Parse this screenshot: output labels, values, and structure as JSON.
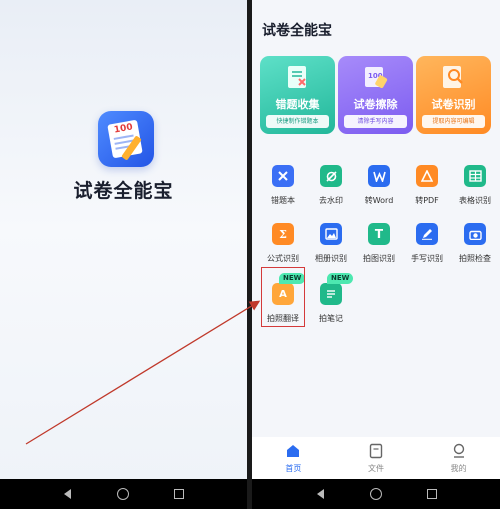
{
  "splash": {
    "app_name": "试卷全能宝"
  },
  "home": {
    "app_title": "试卷全能宝",
    "feature_cards": [
      {
        "title": "错题收集",
        "subtitle": "快捷制作错题本",
        "icon": "mistake-collection-icon"
      },
      {
        "title": "试卷擦除",
        "subtitle": "清除手写内容",
        "icon": "paper-erase-icon"
      },
      {
        "title": "试卷识别",
        "subtitle": "提取内容可编辑",
        "icon": "paper-recognition-icon"
      }
    ],
    "tools": [
      {
        "label": "错题本",
        "icon": "x-icon",
        "color": "#3b6ff5"
      },
      {
        "label": "去水印",
        "icon": "watermark-icon",
        "color": "#20b98a"
      },
      {
        "label": "转Word",
        "icon": "word-icon",
        "color": "#2b6cf0"
      },
      {
        "label": "转PDF",
        "icon": "pdf-icon",
        "color": "#ff8a24"
      },
      {
        "label": "表格识别",
        "icon": "table-icon",
        "color": "#20b98a"
      },
      {
        "label": "公式识别",
        "icon": "formula-icon",
        "color": "#ff8a24"
      },
      {
        "label": "相册识别",
        "icon": "album-icon",
        "color": "#2b6cf0"
      },
      {
        "label": "拍图识别",
        "icon": "photo-text-icon",
        "color": "#20b98a"
      },
      {
        "label": "手写识别",
        "icon": "handwriting-icon",
        "color": "#2b6cf0"
      },
      {
        "label": "拍照检查",
        "icon": "camera-icon",
        "color": "#2b6cf0"
      },
      {
        "label": "拍照翻译",
        "icon": "translate-icon",
        "color": "#ff8a24",
        "badge": "NEW"
      },
      {
        "label": "拍笔记",
        "icon": "note-icon",
        "color": "#20b98a",
        "badge": "NEW"
      }
    ],
    "tabs": [
      {
        "label": "首页",
        "icon": "home-icon",
        "active": true
      },
      {
        "label": "文件",
        "icon": "file-icon",
        "active": false
      },
      {
        "label": "我的",
        "icon": "profile-icon",
        "active": false
      }
    ]
  },
  "colors": {
    "accent": "#2b6cf0",
    "annotation": "#c0392b"
  }
}
